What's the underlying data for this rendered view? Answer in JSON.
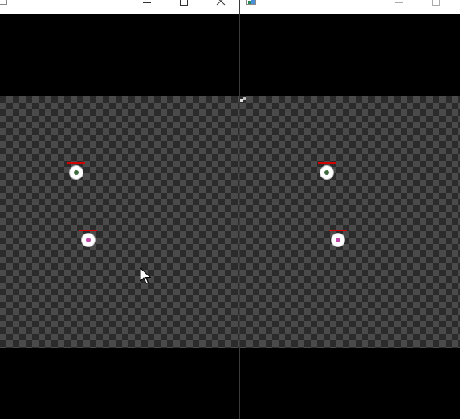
{
  "colors": {
    "viewport_dark": "#2b2b2b",
    "viewport_light": "#4a4a4a",
    "health_bar": "#d40000",
    "pupil_green": "#3e6b3e",
    "pupil_magenta": "#c04aa6",
    "titlebar": "#ffffff",
    "background": "#000000"
  },
  "windows": [
    {
      "name": "left-game-window",
      "controls": [
        "minimize",
        "maximize",
        "close"
      ],
      "sprites": [
        {
          "kind": "eye",
          "pupil_color": "green"
        },
        {
          "kind": "eye",
          "pupil_color": "magenta"
        }
      ]
    },
    {
      "name": "right-game-window",
      "controls": [
        "minimize",
        "maximize"
      ],
      "sprites": [
        {
          "kind": "eye",
          "pupil_color": "green"
        },
        {
          "kind": "eye",
          "pupil_color": "magenta"
        }
      ]
    }
  ],
  "icons": {
    "mouse_cursor": "arrow-cursor-icon",
    "minimize": "minimize-icon",
    "maximize": "maximize-icon",
    "close": "close-icon"
  }
}
